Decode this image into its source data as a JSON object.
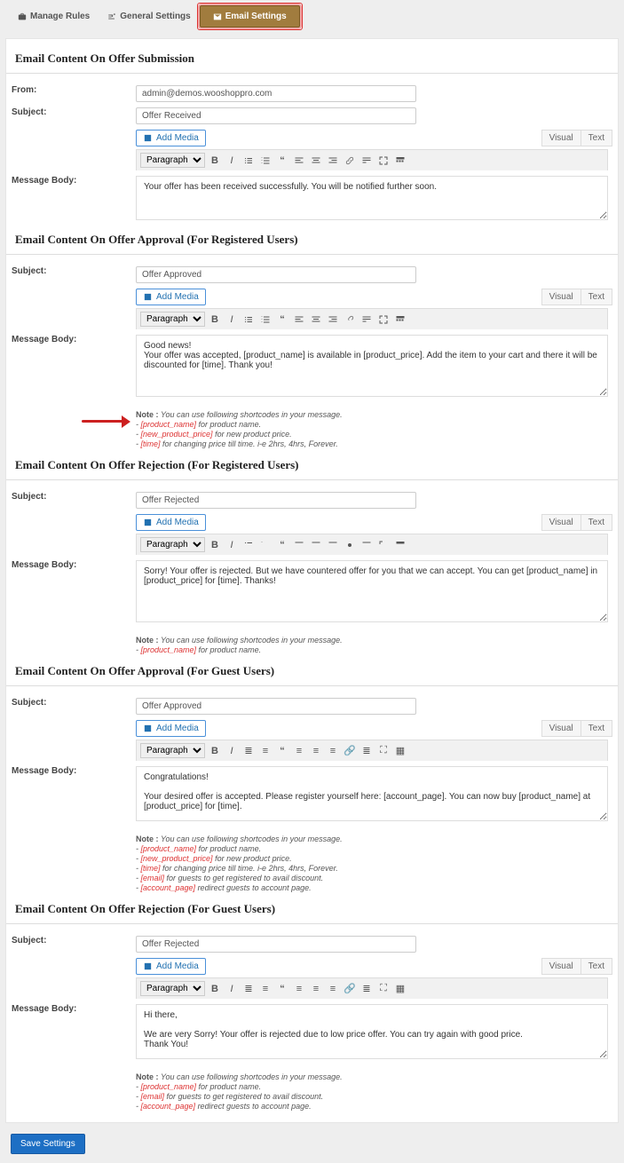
{
  "tabs": {
    "manage": "Manage Rules",
    "general": "General Settings",
    "email": "Email Settings"
  },
  "editor": {
    "paragraph": "Paragraph",
    "visual": "Visual",
    "text": "Text",
    "addMedia": "Add Media"
  },
  "labels": {
    "from": "From:",
    "subject": "Subject:",
    "body": "Message Body:"
  },
  "noteLabel": "Note : You can use following shortcodes in your message.",
  "sc": {
    "pn": "[product_name]",
    "pnTxt": " for product name.",
    "npp": "[new_product_price]",
    "nppTxt": " for new product price.",
    "time": "[time]",
    "timeTxt": " for changing price till time. i-e 2hrs, 4hrs, Forever.",
    "email": "[email]",
    "emailTxt": " for guests to get registered to avail discount.",
    "acc": "[account_page]",
    "accTxt": " redirect guests to account page."
  },
  "sec1": {
    "title": "Email Content On Offer Submission",
    "from": "admin@demos.wooshoppro.com",
    "subject": "Offer Received",
    "body": "Your offer has been received successfully. You will be notified further soon."
  },
  "sec2": {
    "title": "Email Content On Offer Approval (For Registered Users)",
    "subject": "Offer Approved",
    "body": "Good news!\nYour offer was accepted, [product_name] is available in [product_price]. Add the item to your cart and there it will be discounted for [time]. Thank you!"
  },
  "sec3": {
    "title": "Email Content On Offer Rejection (For Registered Users)",
    "subject": "Offer Rejected",
    "body": "Sorry! Your offer is rejected. But we have countered offer for you that we can accept. You can get [product_name] in [product_price] for [time]. Thanks!"
  },
  "sec4": {
    "title": "Email Content On Offer Approval (For Guest Users)",
    "subject": "Offer Approved",
    "body": "Congratulations!\n\nYour desired offer is accepted. Please register yourself here: [account_page]. You can now buy [product_name] at [product_price] for [time].\n\nNote: Please use this [email] for registration to get your offer."
  },
  "sec5": {
    "title": "Email Content On Offer Rejection (For Guest Users)",
    "subject": "Offer Rejected",
    "body": "Hi there,\n\nWe are very Sorry! Your offer is rejected due to low price offer. You can try again with good price.\nThank You!"
  },
  "save": "Save Settings"
}
